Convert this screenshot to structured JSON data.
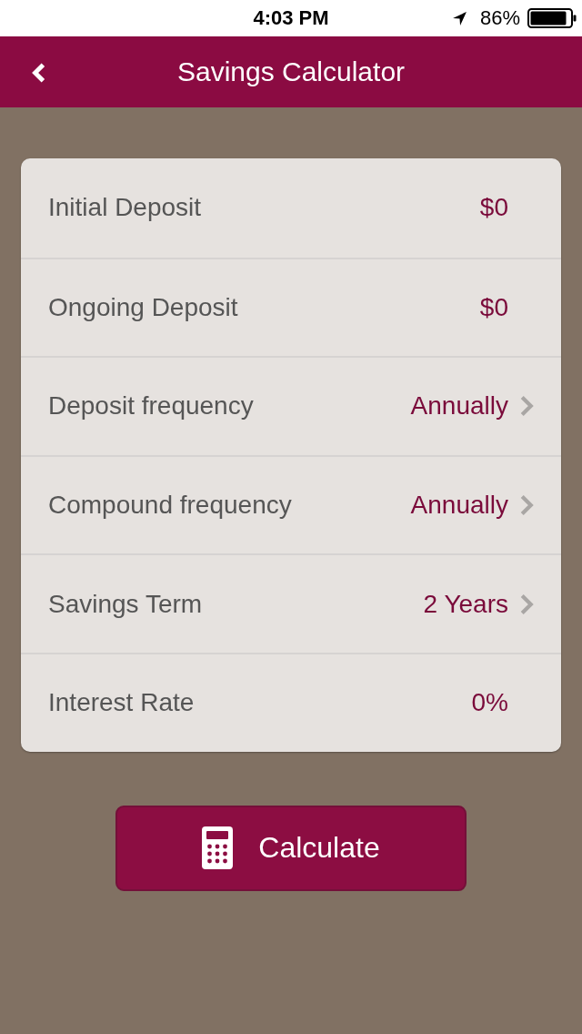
{
  "status_bar": {
    "time": "4:03 PM",
    "battery": "86%"
  },
  "header": {
    "title": "Savings Calculator"
  },
  "fields": [
    {
      "kind": "input",
      "label": "Initial Deposit",
      "value": "$0"
    },
    {
      "kind": "input",
      "label": "Ongoing Deposit",
      "value": "$0"
    },
    {
      "kind": "select",
      "label": "Deposit frequency",
      "value": "Annually"
    },
    {
      "kind": "select",
      "label": "Compound frequency",
      "value": "Annually"
    },
    {
      "kind": "select",
      "label": "Savings Term",
      "value": "2 Years"
    },
    {
      "kind": "input",
      "label": "Interest Rate",
      "value": "0%"
    }
  ],
  "button": {
    "label": "Calculate"
  }
}
